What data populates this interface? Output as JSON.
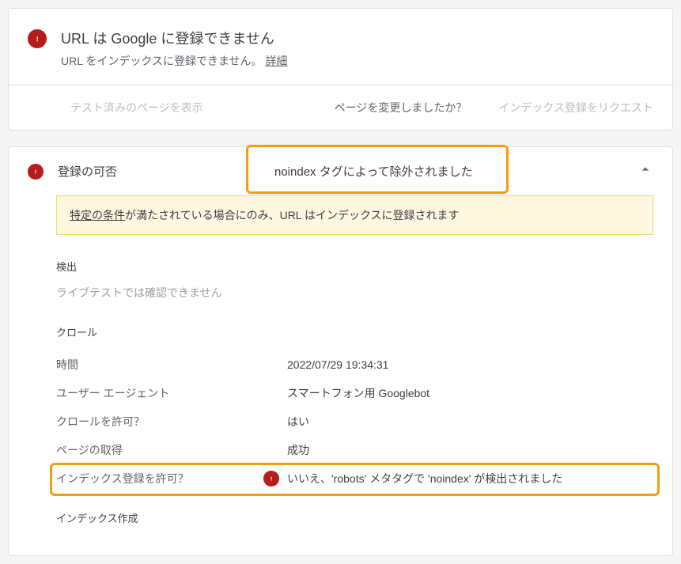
{
  "header": {
    "title": "URL は Google に登録できません",
    "subtitle": "URL をインデックスに登録できません。",
    "details_link": "詳細"
  },
  "actions": {
    "view_tested": "テスト済みのページを表示",
    "page_changed": "ページを変更しましたか？",
    "request_index": "インデックス登録をリクエスト"
  },
  "panel": {
    "title": "登録の可否",
    "status": "noindex タグによって除外されました"
  },
  "notice": {
    "link_text": "特定の条件",
    "text": "が満たされている場合にのみ、URL はインデックスに登録されます"
  },
  "sections": {
    "detection": {
      "label": "検出",
      "text": "ライブテストでは確認できません"
    },
    "crawl": {
      "label": "クロール"
    },
    "indexing": {
      "label": "インデックス作成"
    }
  },
  "crawl_rows": {
    "time": {
      "key": "時間",
      "value": "2022/07/29 19:34:31"
    },
    "agent": {
      "key": "ユーザー エージェント",
      "value": "スマートフォン用 Googlebot"
    },
    "allow_crawl": {
      "key": "クロールを許可？",
      "value": "はい"
    },
    "page_fetch": {
      "key": "ページの取得",
      "value": "成功"
    },
    "allow_index": {
      "key": "インデックス登録を許可？",
      "value": "いいえ、'robots' メタタグで 'noindex' が検出されました"
    }
  }
}
